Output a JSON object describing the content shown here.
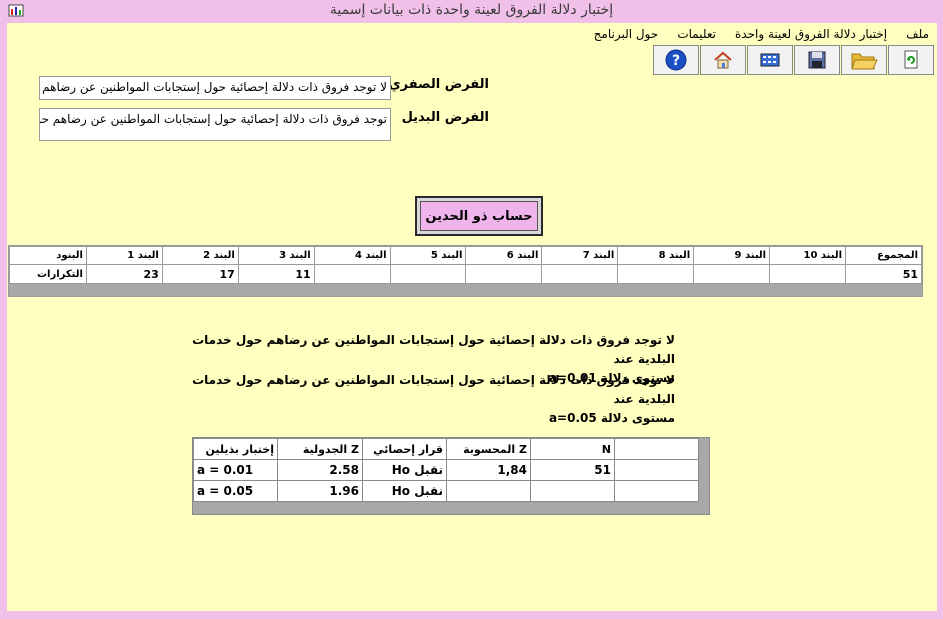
{
  "window": {
    "title": "إختبار دلالة الفروق لعينة واحدة ذات بيانات إسمية"
  },
  "menu": [
    "ملف",
    "إختبار دلالة الفروق لعينة واحدة",
    "تعليمات",
    "حول البرنامج"
  ],
  "toolbar": {
    "icons": [
      "refresh-icon",
      "folder-icon",
      "save-icon",
      "calculator-icon",
      "home-icon",
      "help-icon"
    ]
  },
  "hypotheses": {
    "null_label": "الفرض الصفري",
    "null_value": "لا توجد فروق ذات دلالة إحصائية حول إستجابات المواطنين عن رضاهم حول خدمات البلدية",
    "alt_label": "الفرض البديل",
    "alt_value": "توجد فروق ذات دلالة إحصائية حول إستجابات المواطنين عن رضاهم حول خدمات البلدية"
  },
  "calc_button": "حساب ذو الحدين",
  "items_grid": {
    "row_header": "البنود",
    "row_label": "التكرارات",
    "columns": [
      "البند 1",
      "البند 2",
      "البند 3",
      "البند 4",
      "البند 5",
      "البند 6",
      "البند 7",
      "البند 8",
      "البند 9",
      "البند 10",
      "المجموع"
    ],
    "values": [
      "23",
      "17",
      "11",
      "",
      "",
      "",
      "",
      "",
      "",
      "",
      "51"
    ]
  },
  "results": {
    "line1": "لا توجد فروق ذات دلالة إحصائية حول إستجابات المواطنين عن رضاهم حول خدمات البلدية عند",
    "line2": "مستوى دلالة a=0.01",
    "line3": "لا توجد فروق ذات دلالة إحصائية حول إستجابات المواطنين عن رضاهم حول خدمات البلدية عند",
    "line4": "مستوى دلالة a=0.05"
  },
  "decision_grid": {
    "headers": [
      "إختبار بذيلين",
      "Z الجدولية",
      "قرار إحصائي",
      "Z المحسوبة",
      "N",
      ""
    ],
    "rows": [
      [
        "a = 0.01",
        "2.58",
        "نقبل Ho",
        "1,84",
        "51",
        ""
      ],
      [
        "a = 0.05",
        "1.96",
        "نقبل Ho",
        "",
        "",
        ""
      ]
    ]
  }
}
